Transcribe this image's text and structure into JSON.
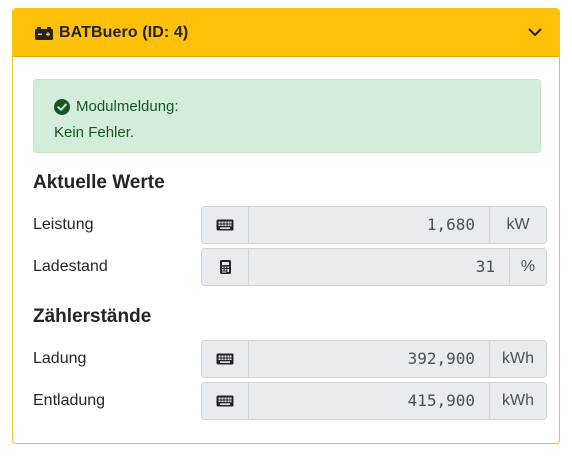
{
  "header": {
    "title": "BATBuero (ID: 4)",
    "icon": "car-battery-icon",
    "toggle_icon": "chevron-down-icon"
  },
  "alert": {
    "title": "Modulmeldung:",
    "message": "Kein Fehler.",
    "icon": "check-circle-icon"
  },
  "sections": {
    "current": {
      "heading": "Aktuelle Werte",
      "fields": [
        {
          "label": "Leistung",
          "value": "1,680",
          "unit": "kW",
          "icon": "keyboard-icon"
        },
        {
          "label": "Ladestand",
          "value": "31",
          "unit": "%",
          "icon": "calculator-icon"
        }
      ]
    },
    "counters": {
      "heading": "Zählerstände",
      "fields": [
        {
          "label": "Ladung",
          "value": "392,900",
          "unit": "kWh",
          "icon": "keyboard-icon"
        },
        {
          "label": "Entladung",
          "value": "415,900",
          "unit": "kWh",
          "icon": "keyboard-icon"
        }
      ]
    }
  },
  "colors": {
    "header_bg": "#ffc107",
    "alert_bg": "#d4edda",
    "alert_text": "#155724",
    "input_bg": "#e9ecef"
  }
}
